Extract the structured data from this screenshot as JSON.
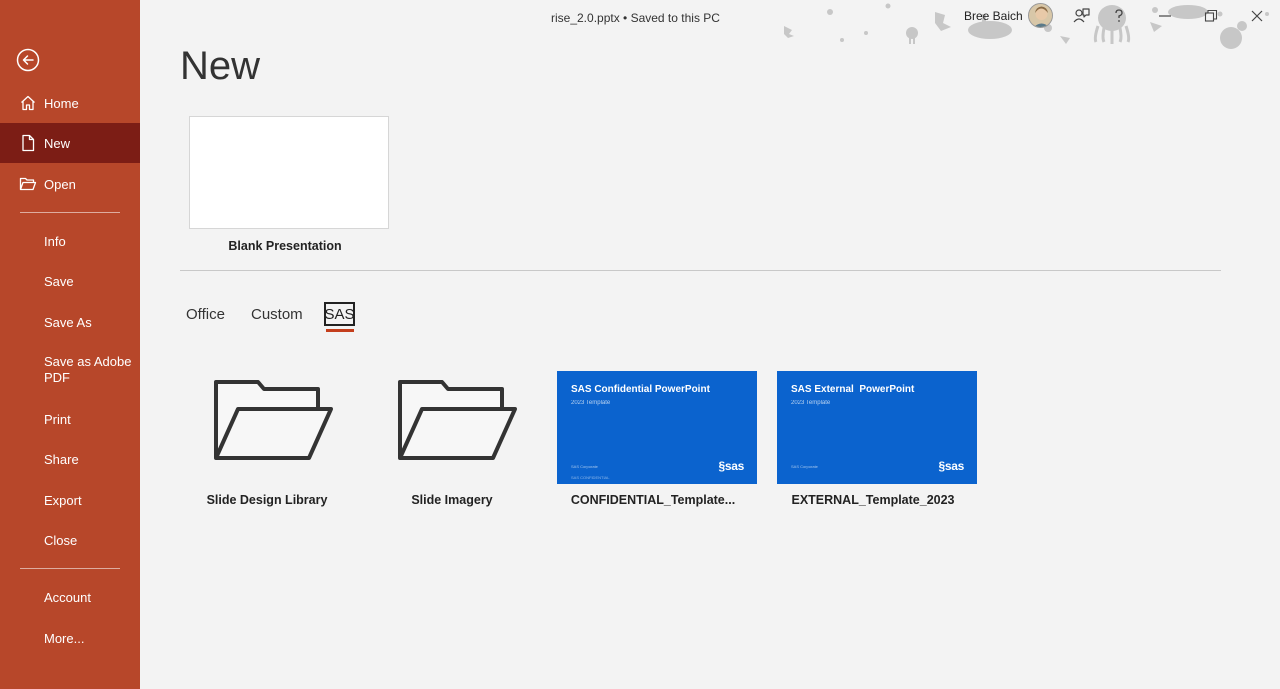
{
  "window": {
    "doc_title": "rise_2.0.pptx • Saved to this PC",
    "user_name": "Bree Baich"
  },
  "sidebar": {
    "items": [
      {
        "label": "Home"
      },
      {
        "label": "New"
      },
      {
        "label": "Open"
      },
      {
        "label": "Info"
      },
      {
        "label": "Save"
      },
      {
        "label": "Save As"
      },
      {
        "label": "Save as Adobe PDF"
      },
      {
        "label": "Print"
      },
      {
        "label": "Share"
      },
      {
        "label": "Export"
      },
      {
        "label": "Close"
      },
      {
        "label": "Account"
      },
      {
        "label": "More..."
      }
    ],
    "active_item": "New"
  },
  "main": {
    "title": "New",
    "blank": {
      "label": "Blank Presentation"
    },
    "tabs": [
      {
        "label": "Office"
      },
      {
        "label": "Custom"
      },
      {
        "label": "SAS"
      }
    ],
    "active_tab": "SAS",
    "templates": [
      {
        "label": "Slide Design Library",
        "icon": "folder-icon"
      },
      {
        "label": "Slide Imagery",
        "icon": "folder-icon"
      },
      {
        "label": "CONFIDENTIAL_Template...",
        "thumb_title": "SAS Confidential PowerPoint",
        "thumb_sub": "2023 Template",
        "thumb_foot": "SAS Corporate",
        "thumb_foot2": "SAS CONFIDENTIAL",
        "thumb_logo": "sas"
      },
      {
        "label": "EXTERNAL_Template_2023",
        "thumb_title": "SAS External  PowerPoint",
        "thumb_sub": "2023 Template",
        "thumb_foot": "SAS Corporate",
        "thumb_logo": "sas"
      }
    ]
  },
  "colors": {
    "sidebar_bg": "#b7472a",
    "sidebar_active": "#7c1d15",
    "accent_underline": "#c43e1c",
    "template_blue": "#0b63ce",
    "page_bg": "#f3f3f3"
  }
}
